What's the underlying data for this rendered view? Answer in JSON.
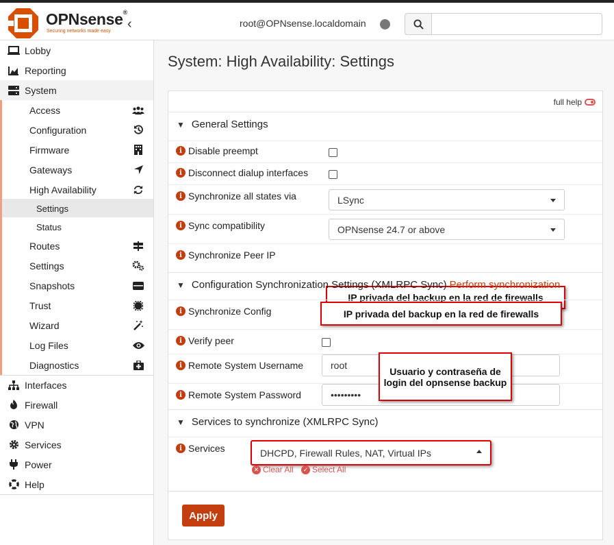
{
  "header": {
    "brand": "OPNsense",
    "registered": "®",
    "tagline": "Securing networks made easy",
    "user": "root@OPNsense.localdomain",
    "search_placeholder": ""
  },
  "sidebar": {
    "items": [
      {
        "label": "Lobby",
        "icon": "laptop-icon"
      },
      {
        "label": "Reporting",
        "icon": "area-chart-icon"
      },
      {
        "label": "System",
        "icon": "server-icon"
      }
    ],
    "system_sub": [
      {
        "label": "Access",
        "icon": "users-icon"
      },
      {
        "label": "Configuration",
        "icon": "history-icon"
      },
      {
        "label": "Firmware",
        "icon": "building-icon"
      },
      {
        "label": "Gateways",
        "icon": "location-arrow-icon"
      },
      {
        "label": "High Availability",
        "icon": "refresh-icon"
      },
      {
        "label": "Settings"
      },
      {
        "label": "Status"
      },
      {
        "label": "Routes",
        "icon": "map-signs-icon"
      },
      {
        "label": "Settings",
        "icon": "cogs-icon"
      },
      {
        "label": "Snapshots",
        "icon": "hdd-icon"
      },
      {
        "label": "Trust",
        "icon": "certificate-icon"
      },
      {
        "label": "Wizard",
        "icon": "magic-icon"
      },
      {
        "label": "Log Files",
        "icon": "eye-icon"
      },
      {
        "label": "Diagnostics",
        "icon": "medkit-icon"
      }
    ],
    "bottom": [
      {
        "label": "Interfaces",
        "icon": "sitemap-icon"
      },
      {
        "label": "Firewall",
        "icon": "fire-icon"
      },
      {
        "label": "VPN",
        "icon": "globe-icon"
      },
      {
        "label": "Services",
        "icon": "cog-icon"
      },
      {
        "label": "Power",
        "icon": "plug-icon"
      },
      {
        "label": "Help",
        "icon": "life-ring-icon"
      }
    ]
  },
  "main": {
    "title": "System: High Availability: Settings",
    "full_help": "full help",
    "sections": {
      "general": "General Settings",
      "config_sync": "Configuration Synchronization Settings (XMLRPC Sync)",
      "perform_sync": "Perform synchronization",
      "services": "Services to synchronize (XMLRPC Sync)"
    },
    "fields": {
      "disable_preempt": "Disable preempt",
      "disconnect_dialup": "Disconnect dialup interfaces",
      "sync_states_via": "Synchronize all states via",
      "sync_states_value": "LSync",
      "sync_compat": "Sync compatibility",
      "sync_compat_value": "OPNsense 24.7 or above",
      "sync_peer_ip": "Synchronize Peer IP",
      "sync_config": "Synchronize Config",
      "verify_peer": "Verify peer",
      "remote_user": "Remote System Username",
      "remote_user_value": "root",
      "remote_pass": "Remote System Password",
      "remote_pass_value": "•••••••••",
      "services": "Services",
      "services_value": "DHCPD, Firewall Rules, NAT, Virtual IPs",
      "clear_all": "Clear All",
      "select_all": "Select All"
    },
    "annotations": {
      "peer_ip": "IP privada del backup en la red de firewalls",
      "sync_config": "IP privada del backup en la red de firewalls",
      "credentials": "Usuario y contraseña de login del opnsense backup"
    },
    "apply": "Apply"
  }
}
